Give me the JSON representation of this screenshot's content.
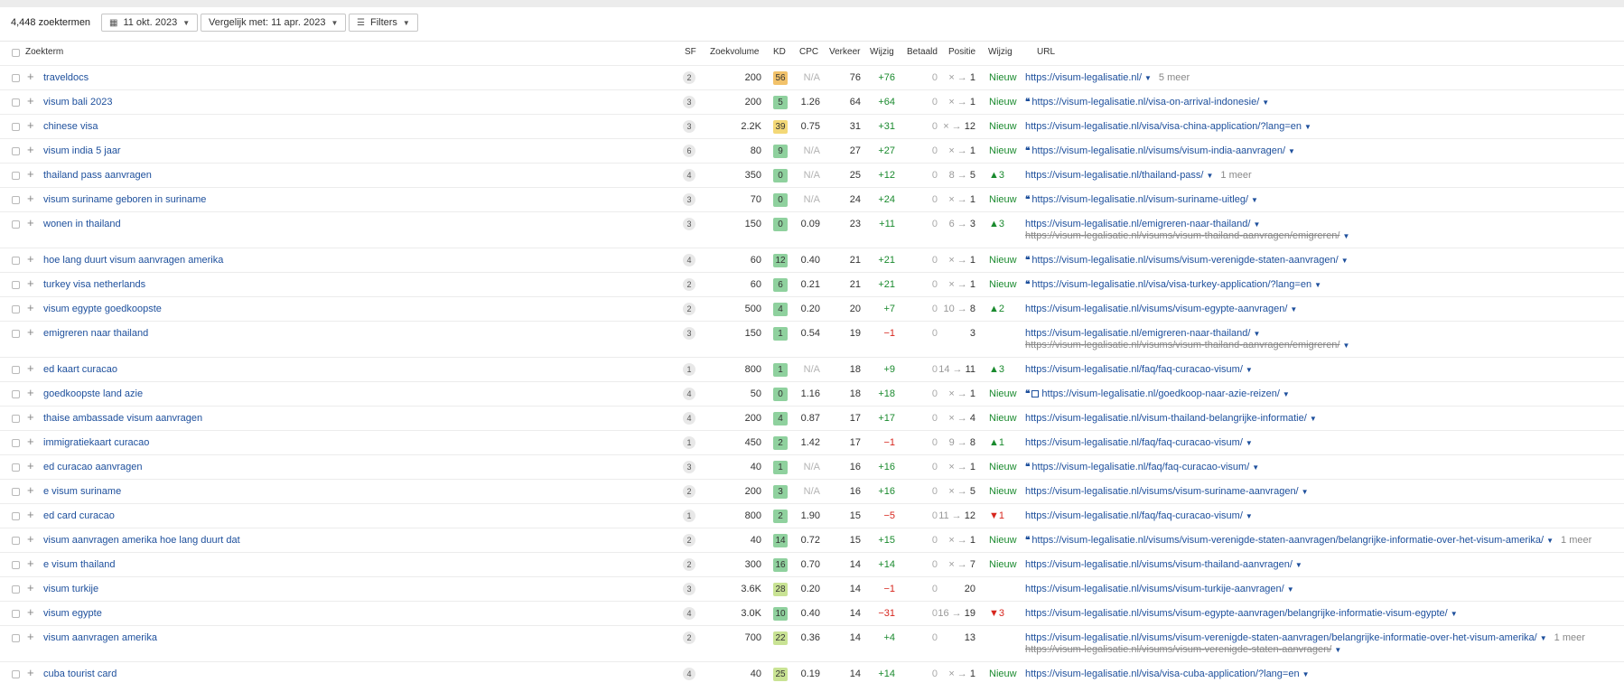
{
  "toolbar": {
    "count": "4,448 zoektermen",
    "date_label": "11 okt. 2023",
    "compare_label": "Vergelijk met: 11 apr. 2023",
    "filters_label": "Filters"
  },
  "columns": {
    "keyword": "Zoekterm",
    "sf": "SF",
    "volume": "Zoekvolume",
    "kd": "KD",
    "cpc": "CPC",
    "traffic": "Verkeer",
    "change": "Wijzig",
    "paid": "Betaald",
    "position": "Positie",
    "pos_change": "Wijzig",
    "url": "URL"
  },
  "colors": {
    "kd_low": "#8fd19e",
    "kd_mid": "#c9e394",
    "kd_yellow": "#f3d877",
    "kd_orange": "#f2c26a",
    "positive": "#1a8a2e",
    "negative": "#d7261e",
    "link": "#1d4f9c"
  },
  "rows": [
    {
      "keyword": "traveldocs",
      "sf": "2",
      "volume": "200",
      "kd": "56",
      "kdc": "#f2c26a",
      "cpc": "N/A",
      "traffic": "76",
      "change": "+76",
      "paid": "0",
      "pos_from": "×",
      "pos_to": "1",
      "pos_change": "Nieuw",
      "pc": "new",
      "url": "https://visum-legalisatie.nl/",
      "old_url": "",
      "more": "5 meer",
      "icons": ""
    },
    {
      "keyword": "visum bali 2023",
      "sf": "3",
      "volume": "200",
      "kd": "5",
      "kdc": "#8fd19e",
      "cpc": "1.26",
      "traffic": "64",
      "change": "+64",
      "paid": "0",
      "pos_from": "×",
      "pos_to": "1",
      "pos_change": "Nieuw",
      "pc": "new",
      "url": "https://visum-legalisatie.nl/visa-on-arrival-indonesie/",
      "old_url": "",
      "more": "",
      "icons": "q"
    },
    {
      "keyword": "chinese visa",
      "sf": "3",
      "volume": "2.2K",
      "kd": "39",
      "kdc": "#f3d877",
      "cpc": "0.75",
      "traffic": "31",
      "change": "+31",
      "paid": "0",
      "pos_from": "×",
      "pos_to": "12",
      "pos_change": "Nieuw",
      "pc": "new",
      "url": "https://visum-legalisatie.nl/visa/visa-china-application/?lang=en",
      "old_url": "",
      "more": "",
      "icons": ""
    },
    {
      "keyword": "visum india 5 jaar",
      "sf": "6",
      "volume": "80",
      "kd": "9",
      "kdc": "#8fd19e",
      "cpc": "N/A",
      "traffic": "27",
      "change": "+27",
      "paid": "0",
      "pos_from": "×",
      "pos_to": "1",
      "pos_change": "Nieuw",
      "pc": "new",
      "url": "https://visum-legalisatie.nl/visums/visum-india-aanvragen/",
      "old_url": "",
      "more": "",
      "icons": "q"
    },
    {
      "keyword": "thailand pass aanvragen",
      "sf": "4",
      "volume": "350",
      "kd": "0",
      "kdc": "#8fd19e",
      "cpc": "N/A",
      "traffic": "25",
      "change": "+12",
      "paid": "0",
      "pos_from": "8",
      "pos_to": "5",
      "pos_change": "▲3",
      "pc": "up",
      "url": "https://visum-legalisatie.nl/thailand-pass/",
      "old_url": "",
      "more": "1 meer",
      "icons": ""
    },
    {
      "keyword": "visum suriname geboren in suriname",
      "sf": "3",
      "volume": "70",
      "kd": "0",
      "kdc": "#8fd19e",
      "cpc": "N/A",
      "traffic": "24",
      "change": "+24",
      "paid": "0",
      "pos_from": "×",
      "pos_to": "1",
      "pos_change": "Nieuw",
      "pc": "new",
      "url": "https://visum-legalisatie.nl/visum-suriname-uitleg/",
      "old_url": "",
      "more": "",
      "icons": "q"
    },
    {
      "keyword": "wonen in thailand",
      "sf": "3",
      "volume": "150",
      "kd": "0",
      "kdc": "#8fd19e",
      "cpc": "0.09",
      "traffic": "23",
      "change": "+11",
      "paid": "0",
      "pos_from": "6",
      "pos_to": "3",
      "pos_change": "▲3",
      "pc": "up",
      "url": "https://visum-legalisatie.nl/emigreren-naar-thailand/",
      "old_url": "https://visum-legalisatie.nl/visums/visum-thailand-aanvragen/emigreren/",
      "more": "",
      "icons": ""
    },
    {
      "keyword": "hoe lang duurt visum aanvragen amerika",
      "sf": "4",
      "volume": "60",
      "kd": "12",
      "kdc": "#8fd19e",
      "cpc": "0.40",
      "traffic": "21",
      "change": "+21",
      "paid": "0",
      "pos_from": "×",
      "pos_to": "1",
      "pos_change": "Nieuw",
      "pc": "new",
      "url": "https://visum-legalisatie.nl/visums/visum-verenigde-staten-aanvragen/",
      "old_url": "",
      "more": "",
      "icons": "q"
    },
    {
      "keyword": "turkey visa netherlands",
      "sf": "2",
      "volume": "60",
      "kd": "6",
      "kdc": "#8fd19e",
      "cpc": "0.21",
      "traffic": "21",
      "change": "+21",
      "paid": "0",
      "pos_from": "×",
      "pos_to": "1",
      "pos_change": "Nieuw",
      "pc": "new",
      "url": "https://visum-legalisatie.nl/visa/visa-turkey-application/?lang=en",
      "old_url": "",
      "more": "",
      "icons": "q"
    },
    {
      "keyword": "visum egypte goedkoopste",
      "sf": "2",
      "volume": "500",
      "kd": "4",
      "kdc": "#8fd19e",
      "cpc": "0.20",
      "traffic": "20",
      "change": "+7",
      "paid": "0",
      "pos_from": "10",
      "pos_to": "8",
      "pos_change": "▲2",
      "pc": "up",
      "url": "https://visum-legalisatie.nl/visums/visum-egypte-aanvragen/",
      "old_url": "",
      "more": "",
      "icons": ""
    },
    {
      "keyword": "emigreren naar thailand",
      "sf": "3",
      "volume": "150",
      "kd": "1",
      "kdc": "#8fd19e",
      "cpc": "0.54",
      "traffic": "19",
      "change": "−1",
      "paid": "0",
      "pos_from": "",
      "pos_to": "3",
      "pos_change": "",
      "pc": "",
      "url": "https://visum-legalisatie.nl/emigreren-naar-thailand/",
      "old_url": "https://visum-legalisatie.nl/visums/visum-thailand-aanvragen/emigreren/",
      "more": "",
      "icons": ""
    },
    {
      "keyword": "ed kaart curacao",
      "sf": "1",
      "volume": "800",
      "kd": "1",
      "kdc": "#8fd19e",
      "cpc": "N/A",
      "traffic": "18",
      "change": "+9",
      "paid": "0",
      "pos_from": "14",
      "pos_to": "11",
      "pos_change": "▲3",
      "pc": "up",
      "url": "https://visum-legalisatie.nl/faq/faq-curacao-visum/",
      "old_url": "",
      "more": "",
      "icons": ""
    },
    {
      "keyword": "goedkoopste land azie",
      "sf": "4",
      "volume": "50",
      "kd": "0",
      "kdc": "#8fd19e",
      "cpc": "1.16",
      "traffic": "18",
      "change": "+18",
      "paid": "0",
      "pos_from": "×",
      "pos_to": "1",
      "pos_change": "Nieuw",
      "pc": "new",
      "url": "https://visum-legalisatie.nl/goedkoop-naar-azie-reizen/",
      "old_url": "",
      "more": "",
      "icons": "qi"
    },
    {
      "keyword": "thaise ambassade visum aanvragen",
      "sf": "4",
      "volume": "200",
      "kd": "4",
      "kdc": "#8fd19e",
      "cpc": "0.87",
      "traffic": "17",
      "change": "+17",
      "paid": "0",
      "pos_from": "×",
      "pos_to": "4",
      "pos_change": "Nieuw",
      "pc": "new",
      "url": "https://visum-legalisatie.nl/visum-thailand-belangrijke-informatie/",
      "old_url": "",
      "more": "",
      "icons": ""
    },
    {
      "keyword": "immigratiekaart curacao",
      "sf": "1",
      "volume": "450",
      "kd": "2",
      "kdc": "#8fd19e",
      "cpc": "1.42",
      "traffic": "17",
      "change": "−1",
      "paid": "0",
      "pos_from": "9",
      "pos_to": "8",
      "pos_change": "▲1",
      "pc": "up",
      "url": "https://visum-legalisatie.nl/faq/faq-curacao-visum/",
      "old_url": "",
      "more": "",
      "icons": ""
    },
    {
      "keyword": "ed curacao aanvragen",
      "sf": "3",
      "volume": "40",
      "kd": "1",
      "kdc": "#8fd19e",
      "cpc": "N/A",
      "traffic": "16",
      "change": "+16",
      "paid": "0",
      "pos_from": "×",
      "pos_to": "1",
      "pos_change": "Nieuw",
      "pc": "new",
      "url": "https://visum-legalisatie.nl/faq/faq-curacao-visum/",
      "old_url": "",
      "more": "",
      "icons": "q"
    },
    {
      "keyword": "e visum suriname",
      "sf": "2",
      "volume": "200",
      "kd": "3",
      "kdc": "#8fd19e",
      "cpc": "N/A",
      "traffic": "16",
      "change": "+16",
      "paid": "0",
      "pos_from": "×",
      "pos_to": "5",
      "pos_change": "Nieuw",
      "pc": "new",
      "url": "https://visum-legalisatie.nl/visums/visum-suriname-aanvragen/",
      "old_url": "",
      "more": "",
      "icons": ""
    },
    {
      "keyword": "ed card curacao",
      "sf": "1",
      "volume": "800",
      "kd": "2",
      "kdc": "#8fd19e",
      "cpc": "1.90",
      "traffic": "15",
      "change": "−5",
      "paid": "0",
      "pos_from": "11",
      "pos_to": "12",
      "pos_change": "▼1",
      "pc": "down",
      "url": "https://visum-legalisatie.nl/faq/faq-curacao-visum/",
      "old_url": "",
      "more": "",
      "icons": ""
    },
    {
      "keyword": "visum aanvragen amerika hoe lang duurt dat",
      "sf": "2",
      "volume": "40",
      "kd": "14",
      "kdc": "#8fd19e",
      "cpc": "0.72",
      "traffic": "15",
      "change": "+15",
      "paid": "0",
      "pos_from": "×",
      "pos_to": "1",
      "pos_change": "Nieuw",
      "pc": "new",
      "url": "https://visum-legalisatie.nl/visums/visum-verenigde-staten-aanvragen/belangrijke-informatie-over-het-visum-amerika/",
      "old_url": "",
      "more": "1 meer",
      "icons": "q"
    },
    {
      "keyword": "e visum thailand",
      "sf": "2",
      "volume": "300",
      "kd": "16",
      "kdc": "#8fd19e",
      "cpc": "0.70",
      "traffic": "14",
      "change": "+14",
      "paid": "0",
      "pos_from": "×",
      "pos_to": "7",
      "pos_change": "Nieuw",
      "pc": "new",
      "url": "https://visum-legalisatie.nl/visums/visum-thailand-aanvragen/",
      "old_url": "",
      "more": "",
      "icons": ""
    },
    {
      "keyword": "visum turkije",
      "sf": "3",
      "volume": "3.6K",
      "kd": "28",
      "kdc": "#c9e394",
      "cpc": "0.20",
      "traffic": "14",
      "change": "−1",
      "paid": "0",
      "pos_from": "",
      "pos_to": "20",
      "pos_change": "",
      "pc": "",
      "url": "https://visum-legalisatie.nl/visums/visum-turkije-aanvragen/",
      "old_url": "",
      "more": "",
      "icons": ""
    },
    {
      "keyword": "visum egypte",
      "sf": "4",
      "volume": "3.0K",
      "kd": "10",
      "kdc": "#8fd19e",
      "cpc": "0.40",
      "traffic": "14",
      "change": "−31",
      "paid": "0",
      "pos_from": "16",
      "pos_to": "19",
      "pos_change": "▼3",
      "pc": "down",
      "url": "https://visum-legalisatie.nl/visums/visum-egypte-aanvragen/belangrijke-informatie-visum-egypte/",
      "old_url": "",
      "more": "",
      "icons": ""
    },
    {
      "keyword": "visum aanvragen amerika",
      "sf": "2",
      "volume": "700",
      "kd": "22",
      "kdc": "#c9e394",
      "cpc": "0.36",
      "traffic": "14",
      "change": "+4",
      "paid": "0",
      "pos_from": "",
      "pos_to": "13",
      "pos_change": "",
      "pc": "",
      "url": "https://visum-legalisatie.nl/visums/visum-verenigde-staten-aanvragen/belangrijke-informatie-over-het-visum-amerika/",
      "old_url": "https://visum-legalisatie.nl/visums/visum-verenigde-staten-aanvragen/",
      "more": "1 meer",
      "icons": ""
    },
    {
      "keyword": "cuba tourist card",
      "sf": "4",
      "volume": "40",
      "kd": "25",
      "kdc": "#c9e394",
      "cpc": "0.19",
      "traffic": "14",
      "change": "+14",
      "paid": "0",
      "pos_from": "×",
      "pos_to": "1",
      "pos_change": "Nieuw",
      "pc": "new",
      "url": "https://visum-legalisatie.nl/visa/visa-cuba-application/?lang=en",
      "old_url": "",
      "more": "",
      "icons": ""
    }
  ]
}
